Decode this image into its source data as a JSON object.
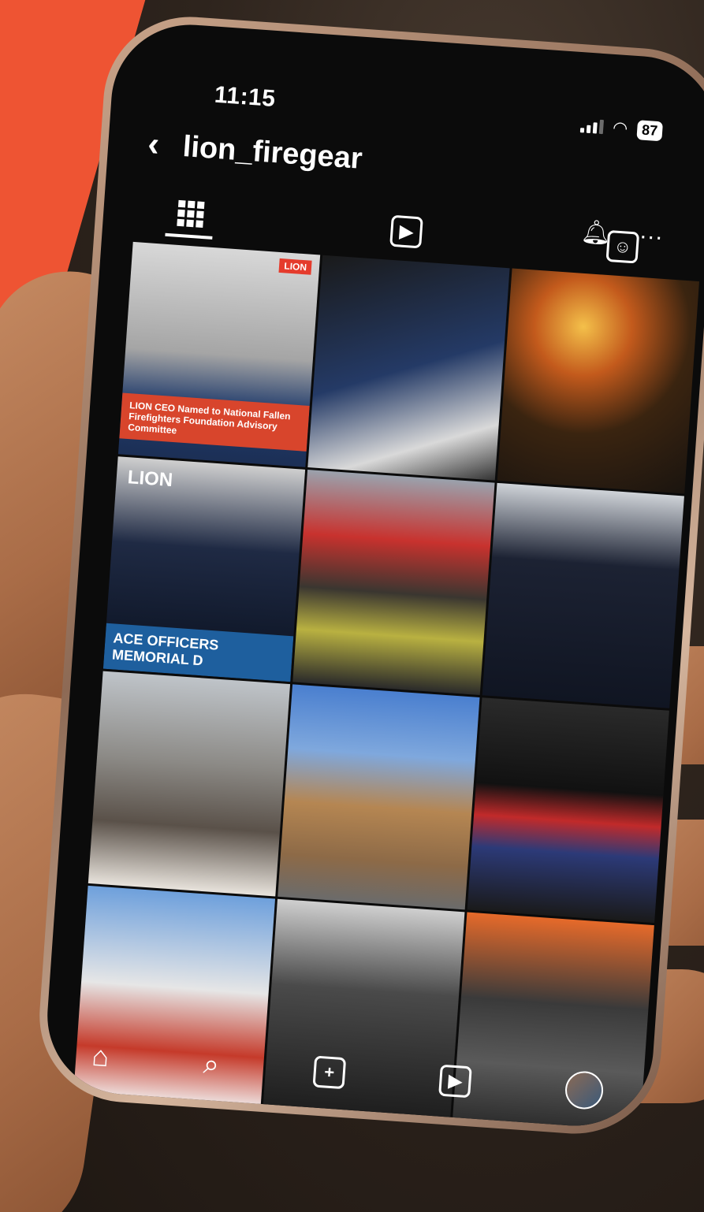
{
  "status_bar": {
    "time": "11:15",
    "battery": "87"
  },
  "header": {
    "username": "lion_firegear"
  },
  "tabs": [
    {
      "name": "grid-tab",
      "icon": "grid-icon"
    },
    {
      "name": "reels-tab",
      "icon": "reels-icon"
    },
    {
      "name": "tagged-tab",
      "icon": "tagged-icon"
    }
  ],
  "posts": [
    {
      "caption": "LION CEO Named to National Fallen Firefighters Foundation Advisory Committee",
      "brand": "LION"
    },
    {
      "caption": ""
    },
    {
      "caption": ""
    },
    {
      "caption": "ACE OFFICERS MEMORIAL D",
      "brand": "LION"
    },
    {
      "caption": ""
    },
    {
      "caption": ""
    },
    {
      "caption": ""
    },
    {
      "caption": ""
    },
    {
      "caption": ""
    },
    {
      "caption": ""
    },
    {
      "caption": ""
    },
    {
      "caption": ""
    }
  ],
  "nav": [
    "home-icon",
    "search-icon",
    "create-icon",
    "reels-icon",
    "profile-avatar"
  ],
  "colors": {
    "accent": "#ee5433",
    "background": "#0b0b0b"
  }
}
